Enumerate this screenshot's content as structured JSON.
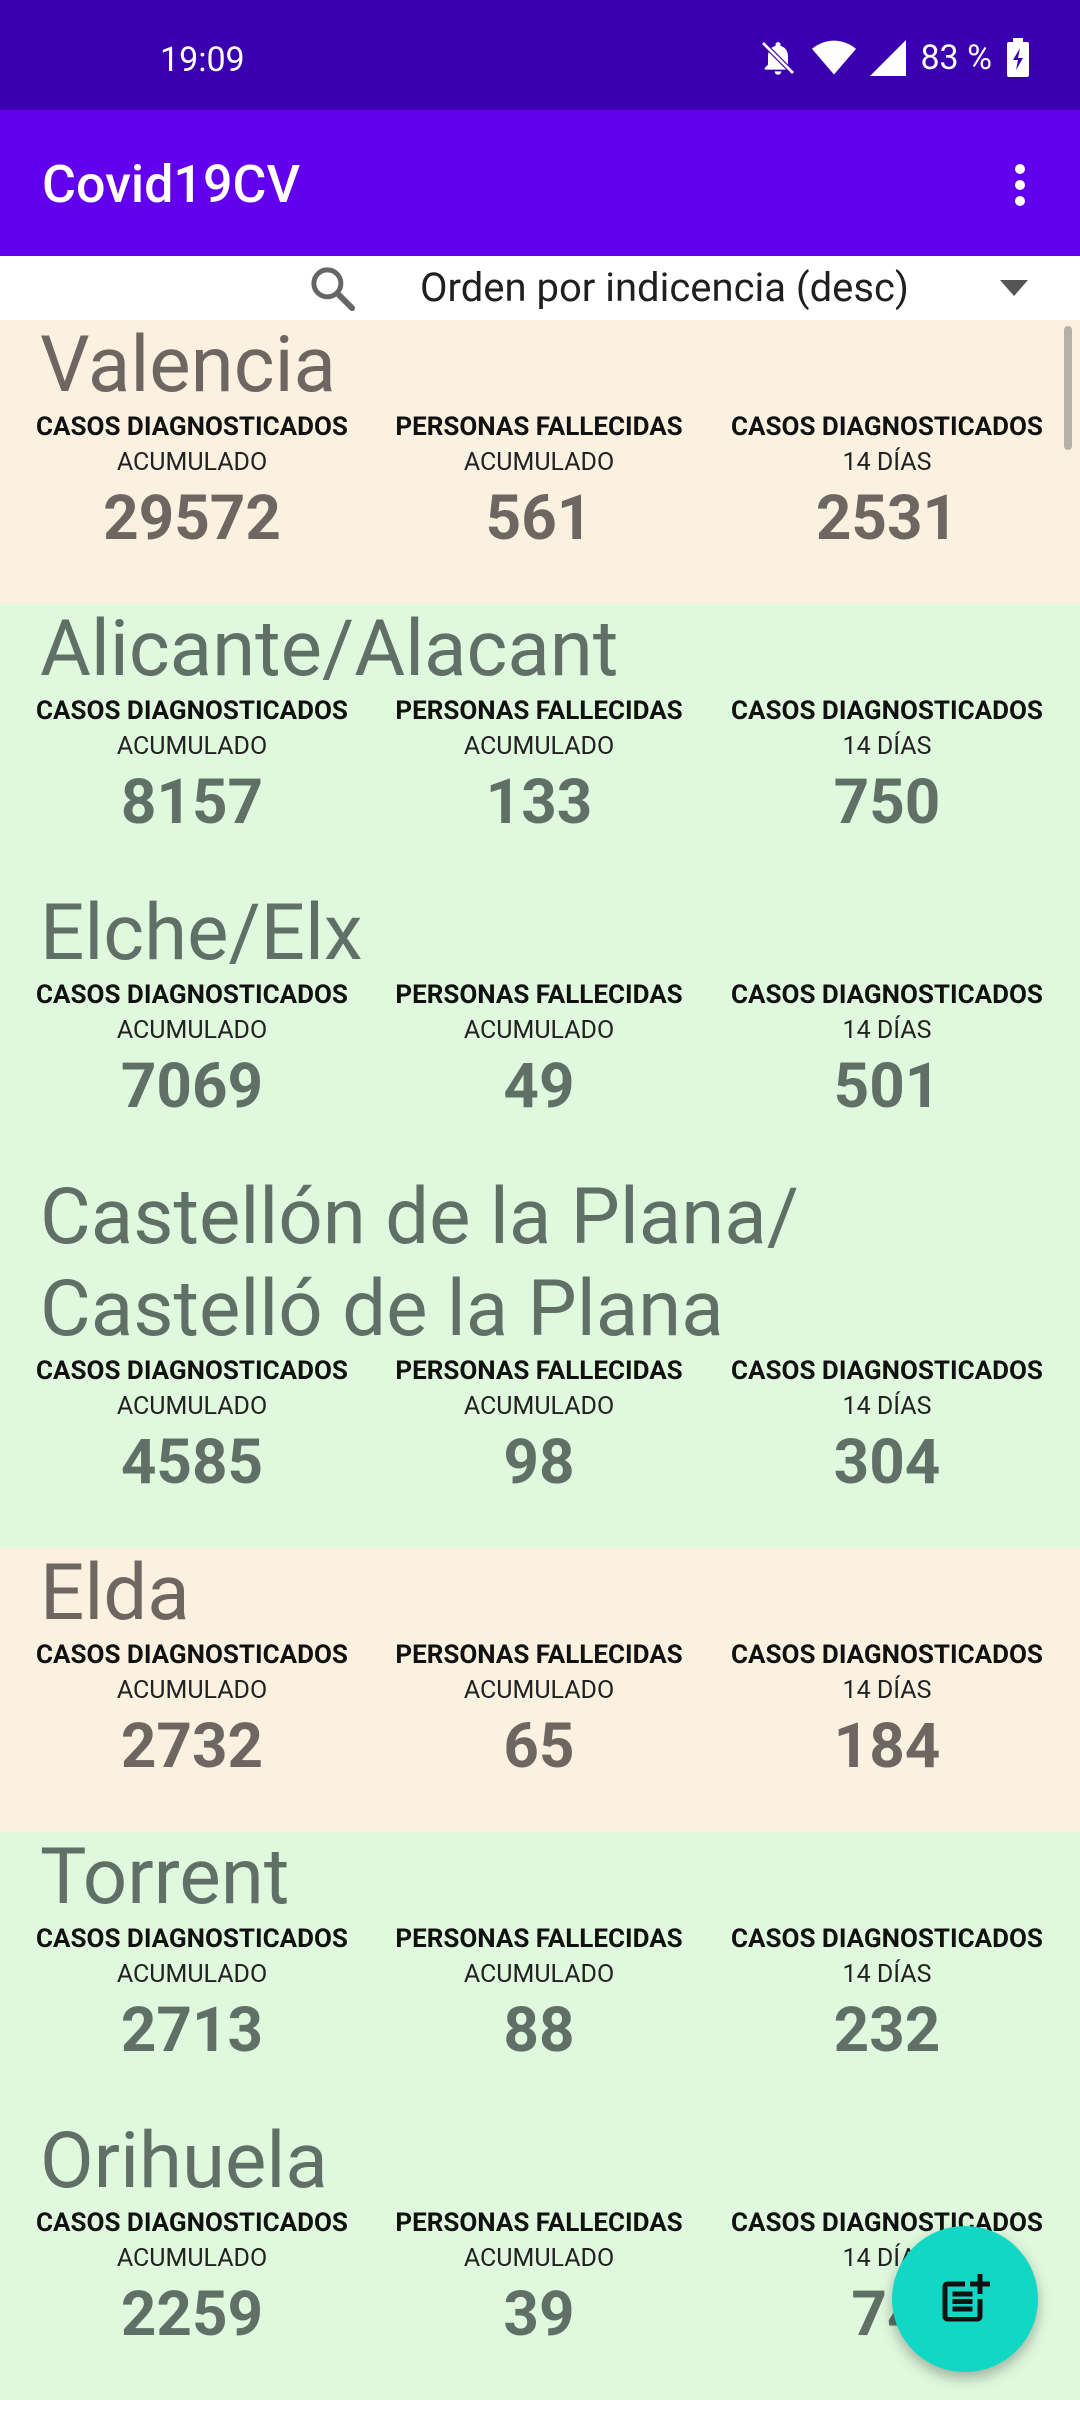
{
  "status_bar": {
    "time": "19:09",
    "battery": "83 %"
  },
  "app_bar": {
    "title": "Covid19CV"
  },
  "toolbar": {
    "sort_label": "Orden por indicencia (desc)"
  },
  "stat_labels": {
    "cases": "CASOS DIAGNOSTICADOS",
    "deaths": "PERSONAS FALLECIDAS",
    "accumulated": "ACUMULADO",
    "fourteen_days": "14 DÍAS"
  },
  "cities": [
    {
      "name": "Valencia",
      "cases_total": "29572",
      "deaths_total": "561",
      "cases_14d": "2531",
      "theme": "warm"
    },
    {
      "name": "Alicante/Alacant",
      "cases_total": "8157",
      "deaths_total": "133",
      "cases_14d": "750",
      "theme": "green"
    },
    {
      "name": "Elche/Elx",
      "cases_total": "7069",
      "deaths_total": "49",
      "cases_14d": "501",
      "theme": "green"
    },
    {
      "name": "Castellón de la Plana/\nCastelló de la Plana",
      "cases_total": "4585",
      "deaths_total": "98",
      "cases_14d": "304",
      "theme": "green"
    },
    {
      "name": "Elda",
      "cases_total": "2732",
      "deaths_total": "65",
      "cases_14d": "184",
      "theme": "warm"
    },
    {
      "name": "Torrent",
      "cases_total": "2713",
      "deaths_total": "88",
      "cases_14d": "232",
      "theme": "green"
    },
    {
      "name": "Orihuela",
      "cases_total": "2259",
      "deaths_total": "39",
      "cases_14d": "74",
      "theme": "green"
    }
  ],
  "colors": {
    "status_bar": "#3a00b0",
    "app_bar": "#6200ee",
    "warm_bg": "#faf1e1",
    "green_bg": "#e0f9de",
    "fab": "#11d8c5"
  }
}
